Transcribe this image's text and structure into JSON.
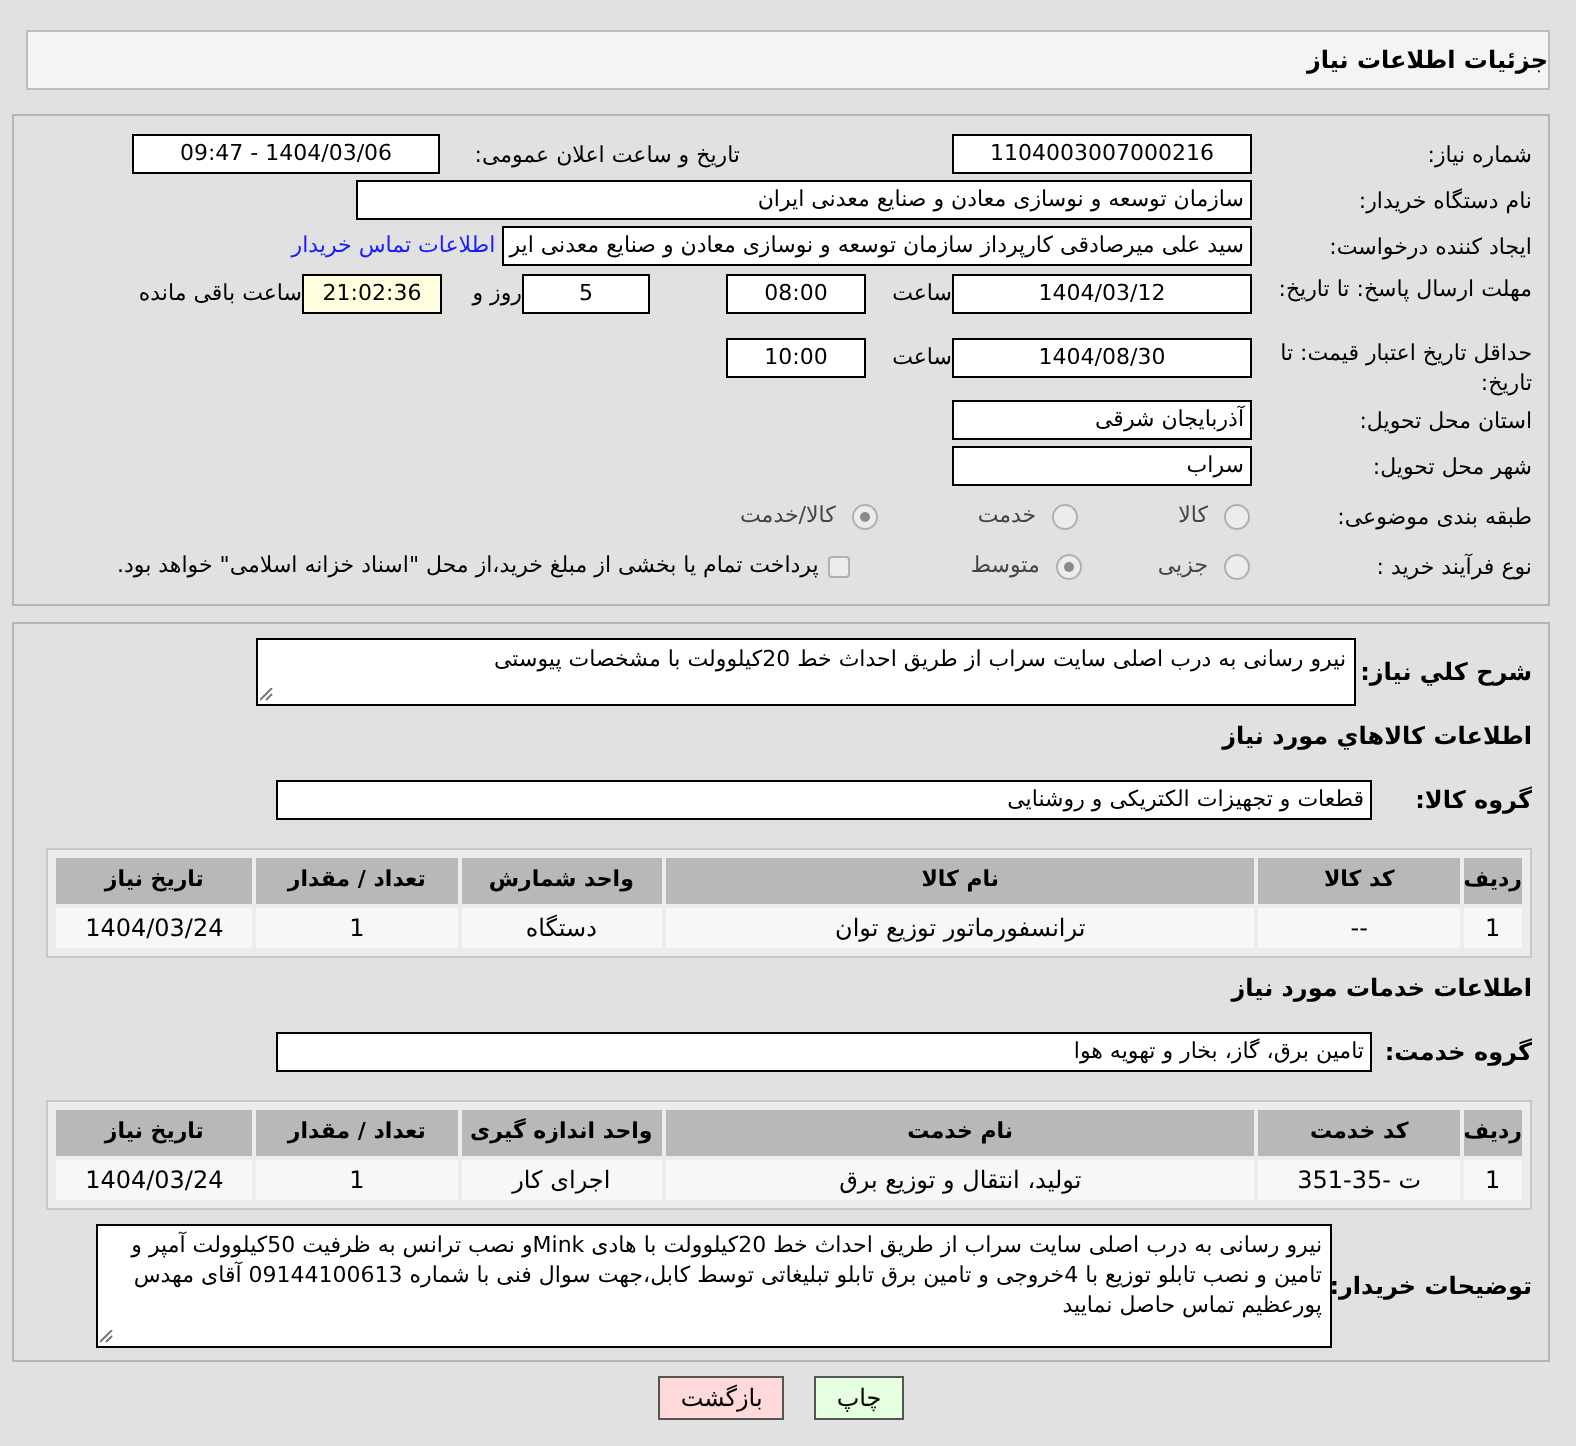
{
  "page": {
    "title": "جزئیات اطلاعات نیاز"
  },
  "need_number": {
    "label": "شماره نیاز:",
    "value": "1104003007000216"
  },
  "announce": {
    "label": "تاریخ و ساعت اعلان عمومی:",
    "value": "1404/03/06 - 09:47"
  },
  "buyer_org": {
    "label": "نام دستگاه خریدار:",
    "value": "سازمان توسعه و نوسازی معادن و صنایع معدنی ایران"
  },
  "requester": {
    "label": "ایجاد کننده درخواست:",
    "value": "سید علی میرصادقی کارپرداز سازمان توسعه و نوسازی معادن و صنایع معدنی ایر",
    "link": "اطلاعات تماس خریدار"
  },
  "deadline": {
    "label": "مهلت ارسال پاسخ: تا تاریخ:",
    "date": "1404/03/12",
    "time_label": "ساعت",
    "time": "08:00",
    "days": "5",
    "days_label": "روز و",
    "remaining": "21:02:36",
    "remaining_label": "ساعت باقی مانده"
  },
  "validity": {
    "label": "حداقل تاریخ اعتبار قیمت: تا تاریخ:",
    "date": "1404/08/30",
    "time_label": "ساعت",
    "time": "10:00"
  },
  "province": {
    "label": "استان محل تحویل:",
    "value": "آذربایجان شرقی"
  },
  "city": {
    "label": "شهر محل تحویل:",
    "value": "سراب"
  },
  "category": {
    "label": "طبقه بندی موضوعی:",
    "options": [
      {
        "label": "کالا",
        "selected": false
      },
      {
        "label": "خدمت",
        "selected": false
      },
      {
        "label": "کالا/خدمت",
        "selected": true
      }
    ]
  },
  "process": {
    "label": "نوع فرآیند خرید :",
    "options": [
      {
        "label": "جزیی",
        "selected": false
      },
      {
        "label": "متوسط",
        "selected": true
      }
    ],
    "payment": {
      "label": "پرداخت تمام یا بخشی از مبلغ خرید،از محل \"اسناد خزانه اسلامی\" خواهد بود.",
      "checked": false
    }
  },
  "description": {
    "label": "شرح کلي نياز:",
    "value": "نیرو رسانی به درب اصلی سایت سراب از طریق احداث خط 20کیلوولت با مشخصات پیوستی"
  },
  "goods": {
    "title": "اطلاعات کالاهاي مورد نياز",
    "group_label": "گروه کالا:",
    "group": "قطعات و تجهیزات الکتریکی و روشنایی",
    "columns": [
      "ردیف",
      "کد کالا",
      "نام کالا",
      "واحد شمارش",
      "تعداد / مقدار",
      "تاریخ نیاز"
    ],
    "rows": [
      [
        "1",
        "--",
        "ترانسفورماتور توزیع توان",
        "دستگاه",
        "1",
        "1404/03/24"
      ]
    ]
  },
  "services": {
    "title": "اطلاعات خدمات مورد نياز",
    "group_label": "گروه خدمت:",
    "group": "تامین برق، گاز، بخار و تهویه هوا",
    "columns": [
      "ردیف",
      "کد خدمت",
      "نام خدمت",
      "واحد اندازه گیری",
      "تعداد / مقدار",
      "تاریخ نیاز"
    ],
    "rows": [
      [
        "1",
        "ت -35-351",
        "تولید، انتقال و توزیع برق",
        "اجرای کار",
        "1",
        "1404/03/24"
      ]
    ]
  },
  "buyer_notes": {
    "label": "توضیحات خریدار:",
    "value": "نیرو رسانی به درب اصلی سایت سراب از طریق احداث خط 20کیلوولت با هادی Minkو نصب ترانس به ظرفیت 50کیلوولت آمپر و تامین و نصب تابلو توزیع با 4خروجی و تامین برق تابلو تبلیغاتی توسط کابل،جهت سوال فنی با شماره 09144100613 آقای مهدس پورعظیم تماس حاصل نمایید"
  },
  "buttons": [
    {
      "label": "چاپ",
      "kind": "print"
    },
    {
      "label": "بازگشت",
      "kind": "back"
    }
  ]
}
